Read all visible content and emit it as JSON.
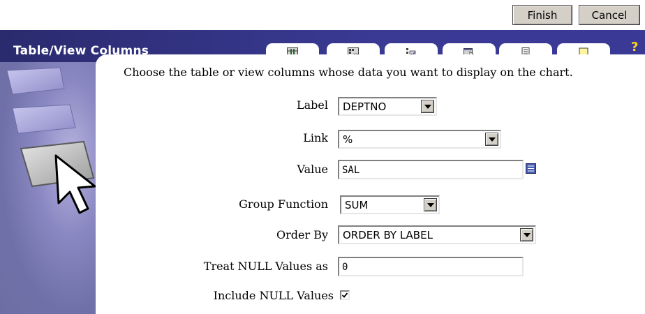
{
  "toolbar": {
    "finish_label": "Finish",
    "cancel_label": "Cancel"
  },
  "panel": {
    "title": "Table/View Columns",
    "help_symbol": "?",
    "tabs": [
      {
        "icon": "table-columns-icon"
      },
      {
        "icon": "xy-chart-icon"
      },
      {
        "icon": "options-icon"
      },
      {
        "icon": "cursor-window-icon"
      },
      {
        "icon": "document-icon"
      },
      {
        "icon": "note-icon"
      }
    ]
  },
  "form": {
    "instruction": "Choose the table or view columns whose data you want to display on the chart.",
    "label_field": {
      "label": "Label",
      "value": "DEPTNO"
    },
    "link_field": {
      "label": "Link",
      "value": "%"
    },
    "value_field": {
      "label": "Value",
      "value": "SAL"
    },
    "group_function": {
      "label": "Group Function",
      "value": "SUM"
    },
    "order_by": {
      "label": "Order By",
      "value": "ORDER BY LABEL"
    },
    "treat_null": {
      "label": "Treat NULL Values as",
      "value": "0"
    },
    "include_null": {
      "label": "Include NULL Values",
      "checked": true
    }
  },
  "colors": {
    "header": "#343486",
    "panel": "#6c6fa4",
    "help": "#ffd61a"
  }
}
